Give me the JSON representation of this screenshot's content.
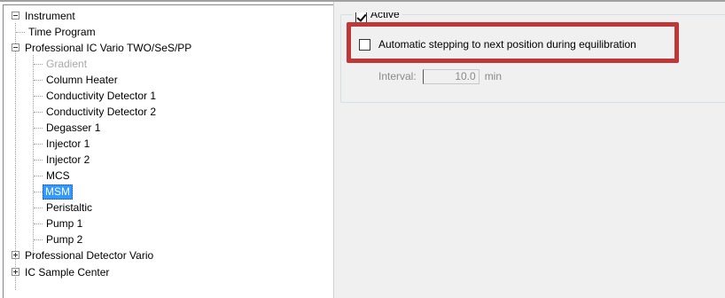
{
  "tree": {
    "items": [
      {
        "label": "Instrument",
        "expander": "minus"
      },
      {
        "label": "Time Program"
      },
      {
        "label": "Professional IC Vario TWO/SeS/PP",
        "expander": "minus"
      },
      {
        "label": "Gradient",
        "disabled": true
      },
      {
        "label": "Column Heater"
      },
      {
        "label": "Conductivity Detector 1"
      },
      {
        "label": "Conductivity Detector 2"
      },
      {
        "label": "Degasser 1"
      },
      {
        "label": "Injector 1"
      },
      {
        "label": "Injector 2"
      },
      {
        "label": "MCS"
      },
      {
        "label": "MSM",
        "selected": true
      },
      {
        "label": "Peristaltic"
      },
      {
        "label": "Pump 1"
      },
      {
        "label": "Pump 2"
      },
      {
        "label": "Professional Detector Vario",
        "expander": "plus"
      },
      {
        "label": "IC Sample Center",
        "expander": "plus"
      }
    ]
  },
  "panel": {
    "group_label": "Active",
    "group_checked": true,
    "option_label": "Automatic stepping to next position during equilibration",
    "option_checked": false,
    "interval_label": "Interval:",
    "interval_value": "10.0",
    "interval_unit": "min"
  },
  "colors": {
    "highlight": "#c0373a",
    "selection": "#3399ff",
    "disabled_text": "#a8a8a8"
  }
}
